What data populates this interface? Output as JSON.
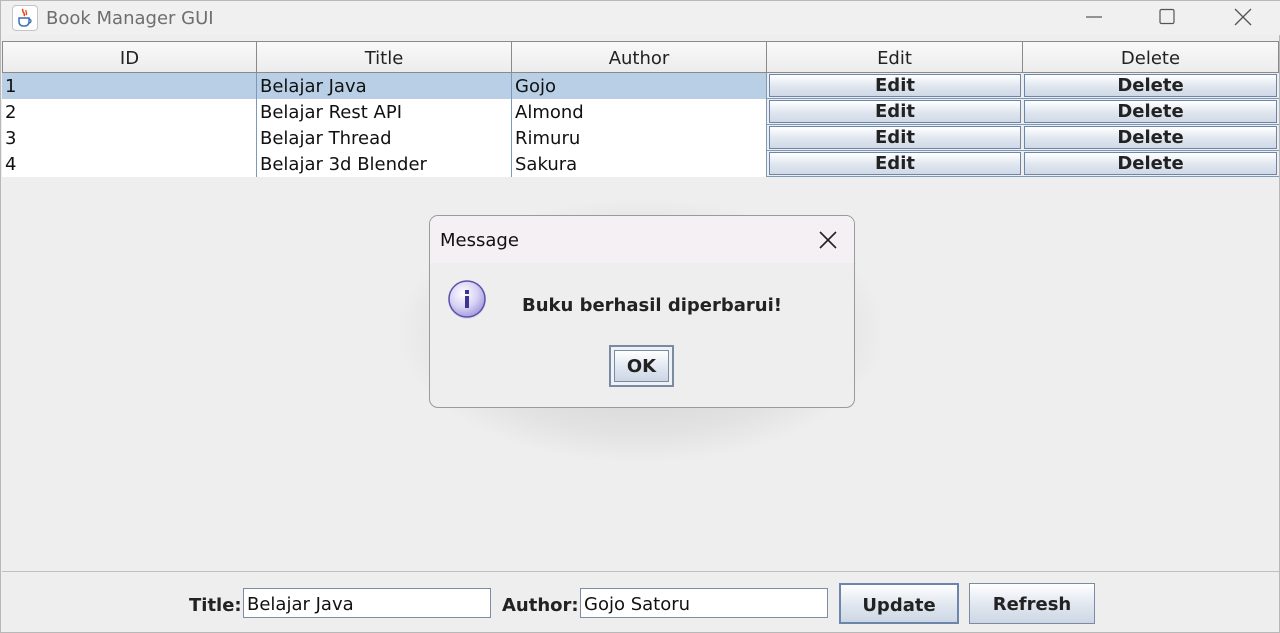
{
  "window": {
    "title": "Book Manager GUI",
    "icon": "java-cup-icon"
  },
  "table": {
    "headers": [
      "ID",
      "Title",
      "Author",
      "Edit",
      "Delete"
    ],
    "rows": [
      {
        "id": "1",
        "title": "Belajar Java",
        "author": "Gojo",
        "edit": "Edit",
        "delete": "Delete",
        "selected": true
      },
      {
        "id": "2",
        "title": "Belajar Rest API",
        "author": "Almond",
        "edit": "Edit",
        "delete": "Delete",
        "selected": false
      },
      {
        "id": "3",
        "title": "Belajar Thread",
        "author": "Rimuru",
        "edit": "Edit",
        "delete": "Delete",
        "selected": false
      },
      {
        "id": "4",
        "title": "Belajar 3d Blender",
        "author": "Sakura",
        "edit": "Edit",
        "delete": "Delete",
        "selected": false
      }
    ]
  },
  "dialog": {
    "title": "Message",
    "message": "Buku berhasil diperbarui!",
    "ok_label": "OK",
    "icon": "info-icon"
  },
  "form": {
    "title_label": "Title:",
    "title_value": "Belajar Java",
    "author_label": "Author:",
    "author_value": "Gojo Satoru",
    "update_label": "Update",
    "refresh_label": "Refresh"
  },
  "colors": {
    "selection": "#b8cfe5",
    "grid": "#7e98b8",
    "background": "#eeeeee"
  }
}
